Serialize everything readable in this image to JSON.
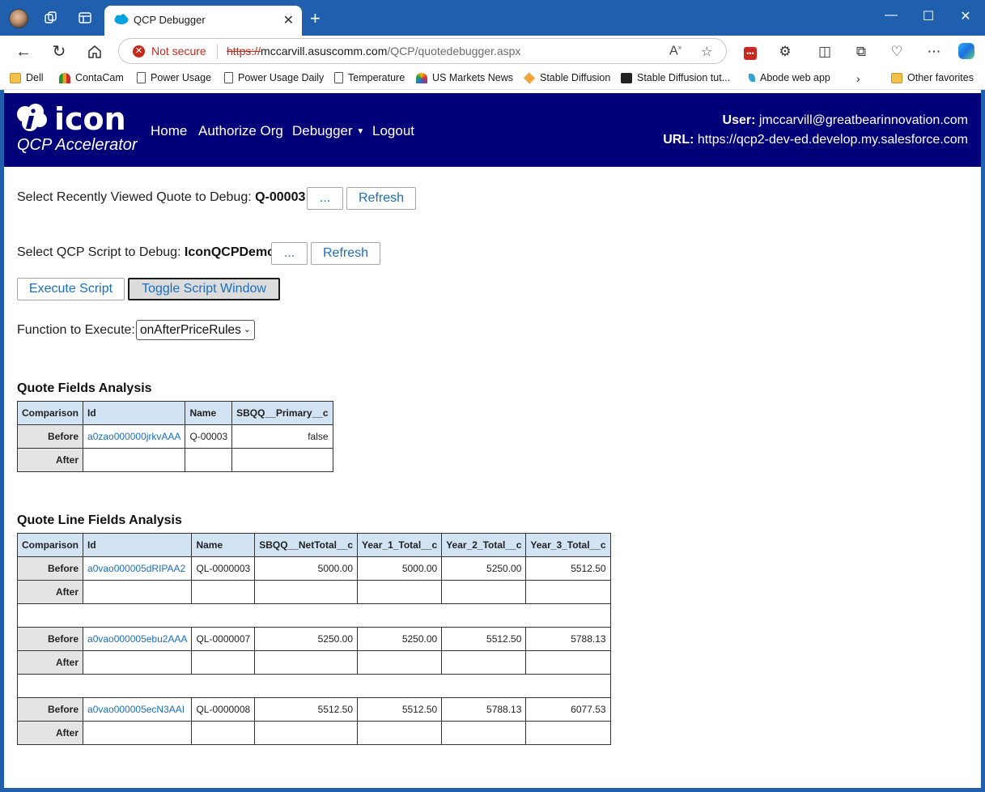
{
  "browser": {
    "tab_title": "QCP Debugger",
    "address": {
      "security_label": "Not secure",
      "url_scheme": "https://",
      "url_host": "mccarvill.asuscomm.com",
      "url_path": "/QCP/quotedebugger.aspx"
    },
    "favorites": [
      {
        "label": "Dell",
        "icon": "folder-icon"
      },
      {
        "label": "ContaCam",
        "icon": "contacam-icon"
      },
      {
        "label": "Power Usage",
        "icon": "page-icon"
      },
      {
        "label": "Power Usage Daily",
        "icon": "page-icon"
      },
      {
        "label": "Temperature",
        "icon": "page-icon"
      },
      {
        "label": "US Markets News",
        "icon": "nbc-icon"
      },
      {
        "label": "Stable Diffusion",
        "icon": "cube-icon"
      },
      {
        "label": "Stable Diffusion tut...",
        "icon": "site-icon"
      },
      {
        "label": "Abode web app",
        "icon": "leaf-icon"
      }
    ],
    "other_favorites": "Other favorites"
  },
  "navbar": {
    "logo_text": "icon",
    "subtitle": "QCP Accelerator",
    "links": [
      "Home",
      "Authorize Org",
      "Debugger",
      "Logout"
    ],
    "user_label": "User:",
    "user_value": "jmccarvill@greatbearinnovation.com",
    "url_label": "URL:",
    "url_value": "https://qcp2-dev-ed.develop.my.salesforce.com"
  },
  "controls": {
    "quote_label": "Select Recently Viewed Quote to Debug:",
    "quote_value": "Q-00003",
    "browse_label": "...",
    "refresh_label": "Refresh",
    "script_label": "Select QCP Script to Debug:",
    "script_value": "IconQCPDemo",
    "execute_label": "Execute Script",
    "toggle_label": "Toggle Script Window",
    "function_label": "Function to Execute:",
    "function_value": "onAfterPriceRules"
  },
  "quote_fields": {
    "title": "Quote Fields Analysis",
    "headers": [
      "Comparison",
      "Id",
      "Name",
      "SBQQ__Primary__c"
    ],
    "before_label": "Before",
    "after_label": "After",
    "before": [
      "a0zao000000jrkvAAA",
      "Q-00003",
      "false"
    ]
  },
  "quote_line_fields": {
    "title": "Quote Line Fields Analysis",
    "headers": [
      "Comparison",
      "Id",
      "Name",
      "SBQQ__NetTotal__c",
      "Year_1_Total__c",
      "Year_2_Total__c",
      "Year_3_Total__c"
    ],
    "before_label": "Before",
    "after_label": "After",
    "lines": [
      [
        "a0vao000005dRIPAA2",
        "QL-0000003",
        "5000.00",
        "5000.00",
        "5250.00",
        "5512.50"
      ],
      [
        "a0vao000005ebu2AAA",
        "QL-0000007",
        "5250.00",
        "5250.00",
        "5512.50",
        "5788.13"
      ],
      [
        "a0vao000005ecN3AAI",
        "QL-0000008",
        "5512.50",
        "5512.50",
        "5788.13",
        "6077.53"
      ]
    ]
  },
  "colors": {
    "navbar": "#010079",
    "link": "#1a6fc0",
    "header_cell": "#d2e4f4",
    "label_cell": "#e4e4e4"
  }
}
